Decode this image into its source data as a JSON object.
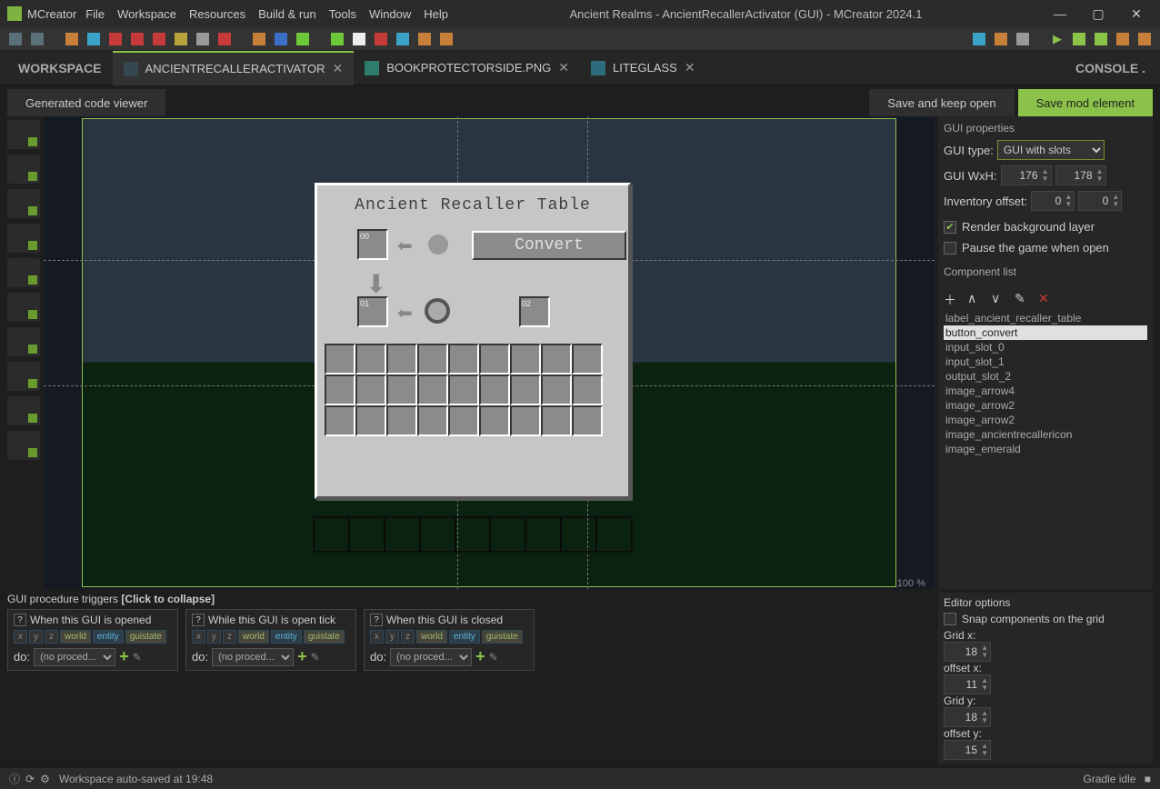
{
  "app": {
    "name": "MCreator",
    "title": "Ancient Realms - AncientRecallerActivator (GUI) - MCreator 2024.1"
  },
  "menu": [
    "File",
    "Workspace",
    "Resources",
    "Build & run",
    "Tools",
    "Window",
    "Help"
  ],
  "tabs": {
    "workspace": "WORKSPACE",
    "items": [
      {
        "label": "ANCIENTRECALLERACTIVATOR",
        "active": true
      },
      {
        "label": "BOOKPROTECTORSIDE.PNG",
        "active": false
      },
      {
        "label": "LITEGLASS",
        "active": false
      }
    ],
    "console": "CONSOLE"
  },
  "header_buttons": {
    "code_viewer": "Generated code viewer",
    "save_keep": "Save and keep open",
    "save_mod": "Save mod element"
  },
  "gui_panel": {
    "title": "Ancient Recaller Table",
    "convert_button": "Convert",
    "slot_labels": [
      "00",
      "01",
      "02"
    ]
  },
  "zoom": "100 %",
  "properties": {
    "section": "GUI properties",
    "gui_type_label": "GUI type:",
    "gui_type_value": "GUI with slots",
    "wxh_label": "GUI WxH:",
    "width": "176",
    "height": "178",
    "inventory_offset_label": "Inventory offset:",
    "inv_off_x": "0",
    "inv_off_y": "0",
    "render_bg": "Render background layer",
    "render_bg_checked": true,
    "pause_game": "Pause the game when open",
    "pause_game_checked": false,
    "component_list_label": "Component list",
    "components": [
      "label_ancient_recaller_table",
      "button_convert",
      "input_slot_0",
      "input_slot_1",
      "output_slot_2",
      "image_arrow4",
      "image_arrow2",
      "image_arrow2",
      "image_ancientrecallericon",
      "image_emerald"
    ],
    "selected_component": "button_convert"
  },
  "triggers": {
    "header": "GUI procedure triggers",
    "header_collapse": "[Click to collapse]",
    "items": [
      {
        "title": "When this GUI is opened"
      },
      {
        "title": "While this GUI is open tick"
      },
      {
        "title": "When this GUI is closed"
      }
    ],
    "vars": [
      "x",
      "y",
      "z",
      "world",
      "entity",
      "guistate"
    ],
    "do_label": "do:",
    "do_select": "(no proced..."
  },
  "editor_options": {
    "section": "Editor options",
    "snap": "Snap components on the grid",
    "grid_x_label": "Grid x:",
    "grid_x": "18",
    "offset_x_label": "offset x:",
    "offset_x": "11",
    "grid_y_label": "Grid y:",
    "grid_y": "18",
    "offset_y_label": "offset y:",
    "offset_y": "15"
  },
  "status": {
    "left": "Workspace auto-saved at 19:48",
    "right": "Gradle idle"
  }
}
